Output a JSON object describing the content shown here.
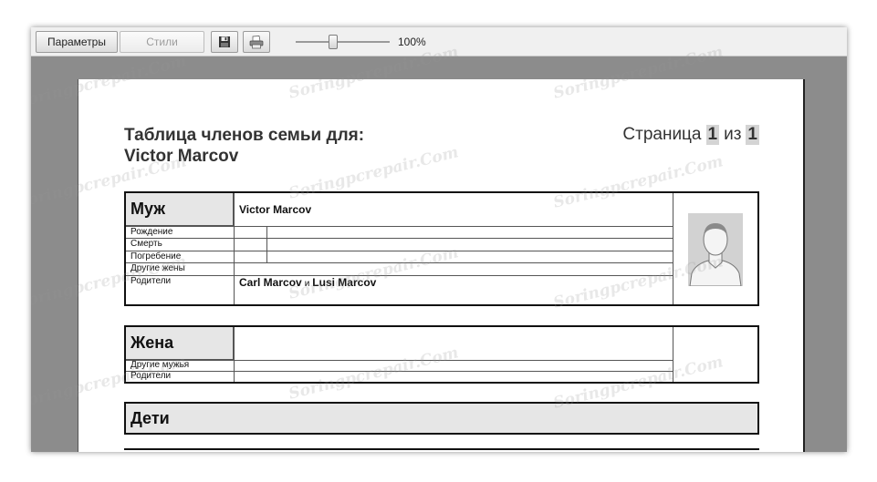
{
  "toolbar": {
    "params_label": "Параметры",
    "styles_label": "Стили",
    "save_icon": "floppy-disk-icon",
    "print_icon": "printer-icon",
    "zoom_value": 100,
    "zoom_label": "100%"
  },
  "document": {
    "title_line1": "Таблица членов семьи для:",
    "title_line2": "Victor Marcov",
    "page_prefix": "Страница",
    "page_current": "1",
    "page_of": "из",
    "page_total": "1"
  },
  "husband": {
    "role": "Муж",
    "name": "Victor Marcov",
    "labels": {
      "birth": "Рождение",
      "death": "Смерть",
      "burial": "Погребение",
      "other_wives": "Другие жены",
      "parents": "Родители"
    },
    "father": "Carl Marcov",
    "and": "и",
    "mother": "Lusi Marcov",
    "photo_icon": "person-silhouette-icon"
  },
  "wife": {
    "role": "Жена",
    "labels": {
      "other_husbands": "Другие мужья",
      "parents": "Родители"
    }
  },
  "children": {
    "role": "Дети"
  },
  "watermark": "Soringpcrepair.Com"
}
